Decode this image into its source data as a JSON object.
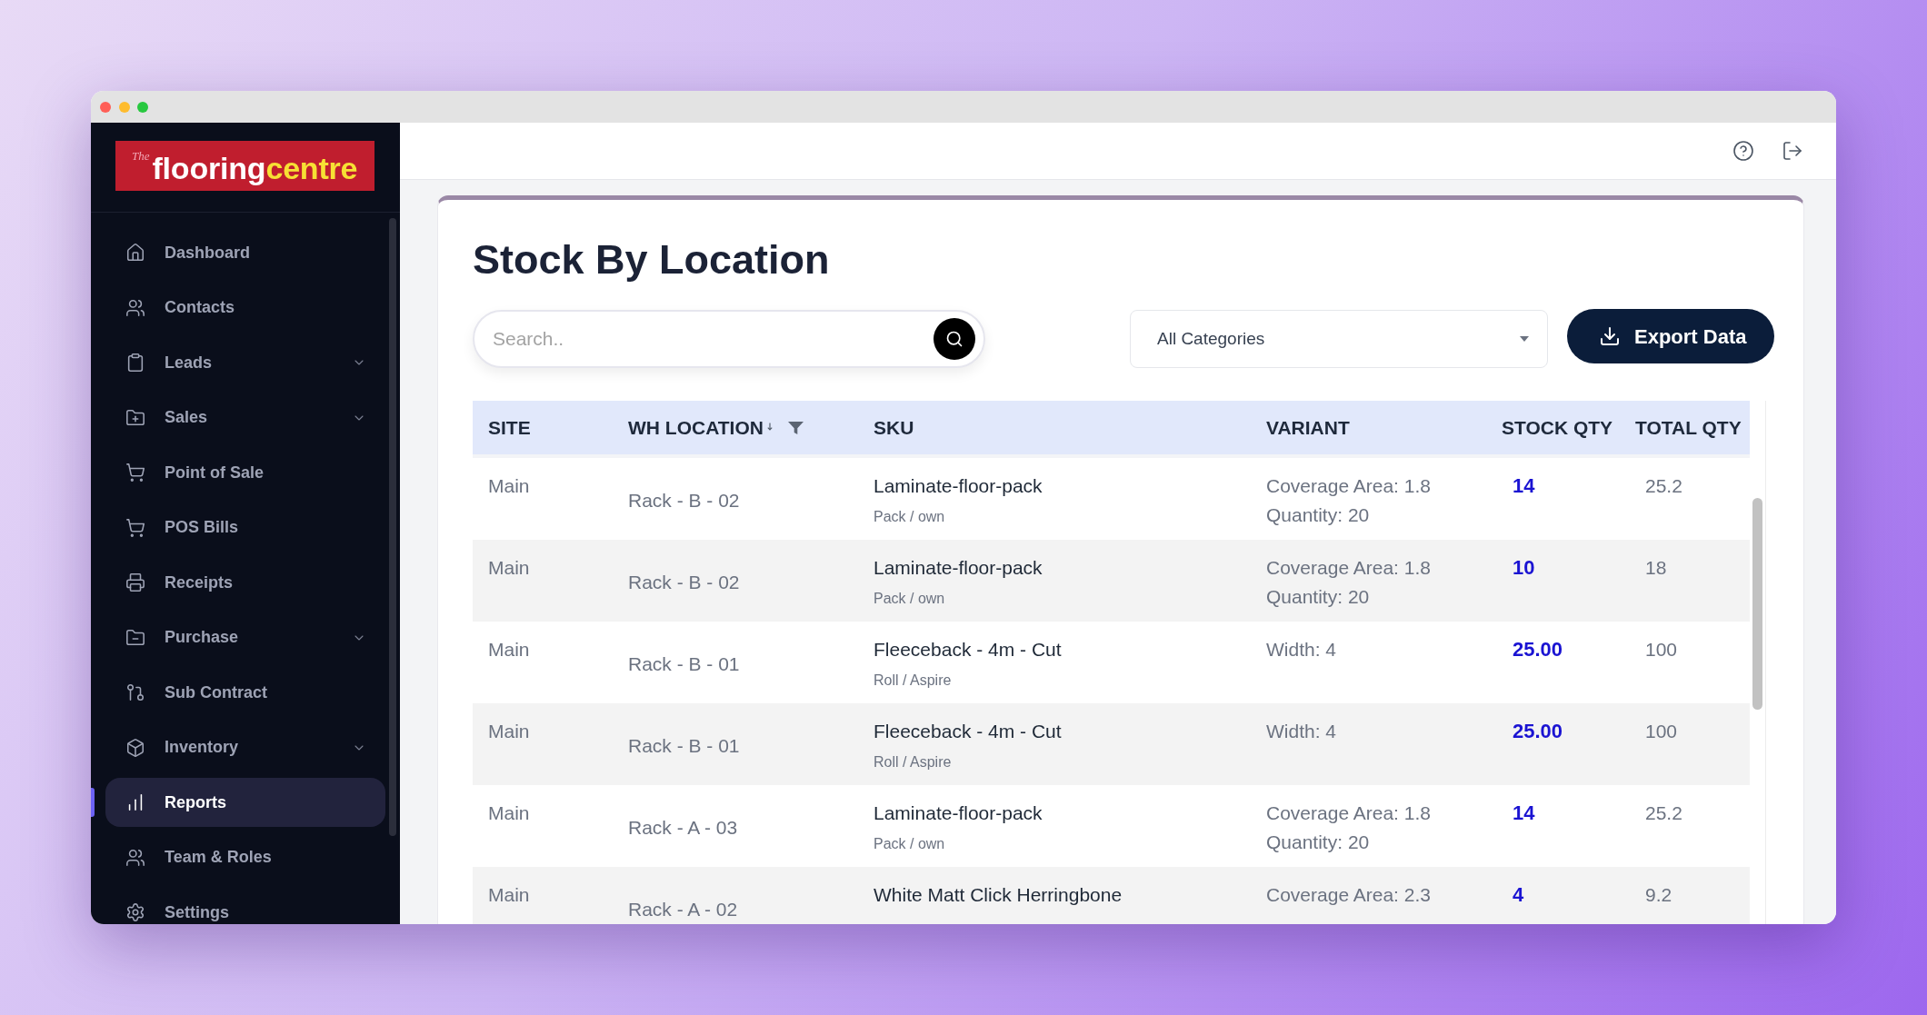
{
  "sidebar": {
    "logo": {
      "script": "The",
      "wordmark": [
        "flooring",
        "centre"
      ]
    },
    "items": [
      {
        "label": "Dashboard",
        "has_submenu": false,
        "selected": false
      },
      {
        "label": "Contacts",
        "has_submenu": false,
        "selected": false
      },
      {
        "label": "Leads",
        "has_submenu": true,
        "selected": false
      },
      {
        "label": "Sales",
        "has_submenu": true,
        "selected": false
      },
      {
        "label": "Point of Sale",
        "has_submenu": false,
        "selected": false
      },
      {
        "label": "POS Bills",
        "has_submenu": false,
        "selected": false
      },
      {
        "label": "Receipts",
        "has_submenu": false,
        "selected": false
      },
      {
        "label": "Purchase",
        "has_submenu": true,
        "selected": false
      },
      {
        "label": "Sub Contract",
        "has_submenu": false,
        "selected": false
      },
      {
        "label": "Inventory",
        "has_submenu": true,
        "selected": false
      },
      {
        "label": "Reports",
        "has_submenu": false,
        "selected": true
      },
      {
        "label": "Team & Roles",
        "has_submenu": false,
        "selected": false
      },
      {
        "label": "Settings",
        "has_submenu": false,
        "selected": false
      }
    ]
  },
  "page": {
    "title": "Stock By Location",
    "search": {
      "placeholder": "Search.."
    },
    "category_select": {
      "value": "All Categories"
    },
    "export_button": {
      "label": "Export Data"
    }
  },
  "table": {
    "columns": [
      {
        "label": "SITE",
        "sorted_descending": false,
        "filter": false
      },
      {
        "label": "WH LOCATION",
        "sorted_descending": true,
        "filter": true
      },
      {
        "label": "SKU",
        "sorted_descending": false,
        "filter": false
      },
      {
        "label": "VARIANT",
        "sorted_descending": false,
        "filter": false
      },
      {
        "label": "STOCK QTY",
        "sorted_descending": false,
        "filter": false
      },
      {
        "label": "TOTAL QTY",
        "sorted_descending": false,
        "filter": false
      }
    ],
    "rows": [
      {
        "site": "Main",
        "location": "Rack - B - 02",
        "sku": "Laminate-floor-pack",
        "sku_detail": "Pack / own",
        "variant": [
          "Coverage Area: 1.8",
          "Quantity: 20"
        ],
        "stock_qty": "14",
        "total_qty": "25.2"
      },
      {
        "site": "Main",
        "location": "Rack - B - 02",
        "sku": "Laminate-floor-pack",
        "sku_detail": "Pack / own",
        "variant": [
          "Coverage Area: 1.8",
          "Quantity: 20"
        ],
        "stock_qty": "10",
        "total_qty": "18"
      },
      {
        "site": "Main",
        "location": "Rack - B - 01",
        "sku": "Fleeceback - 4m - Cut",
        "sku_detail": "Roll / Aspire",
        "variant": [
          "Width: 4"
        ],
        "stock_qty": "25.00",
        "total_qty": "100"
      },
      {
        "site": "Main",
        "location": "Rack - B - 01",
        "sku": "Fleeceback - 4m - Cut",
        "sku_detail": "Roll / Aspire",
        "variant": [
          "Width: 4"
        ],
        "stock_qty": "25.00",
        "total_qty": "100"
      },
      {
        "site": "Main",
        "location": "Rack - A - 03",
        "sku": "Laminate-floor-pack",
        "sku_detail": "Pack / own",
        "variant": [
          "Coverage Area: 1.8",
          "Quantity: 20"
        ],
        "stock_qty": "14",
        "total_qty": "25.2"
      },
      {
        "site": "Main",
        "location": "Rack - A - 02",
        "sku": "White Matt Click Herringbone",
        "variant": [
          "Coverage Area: 2.3"
        ],
        "stock_qty": "4",
        "total_qty": "9.2"
      }
    ]
  }
}
